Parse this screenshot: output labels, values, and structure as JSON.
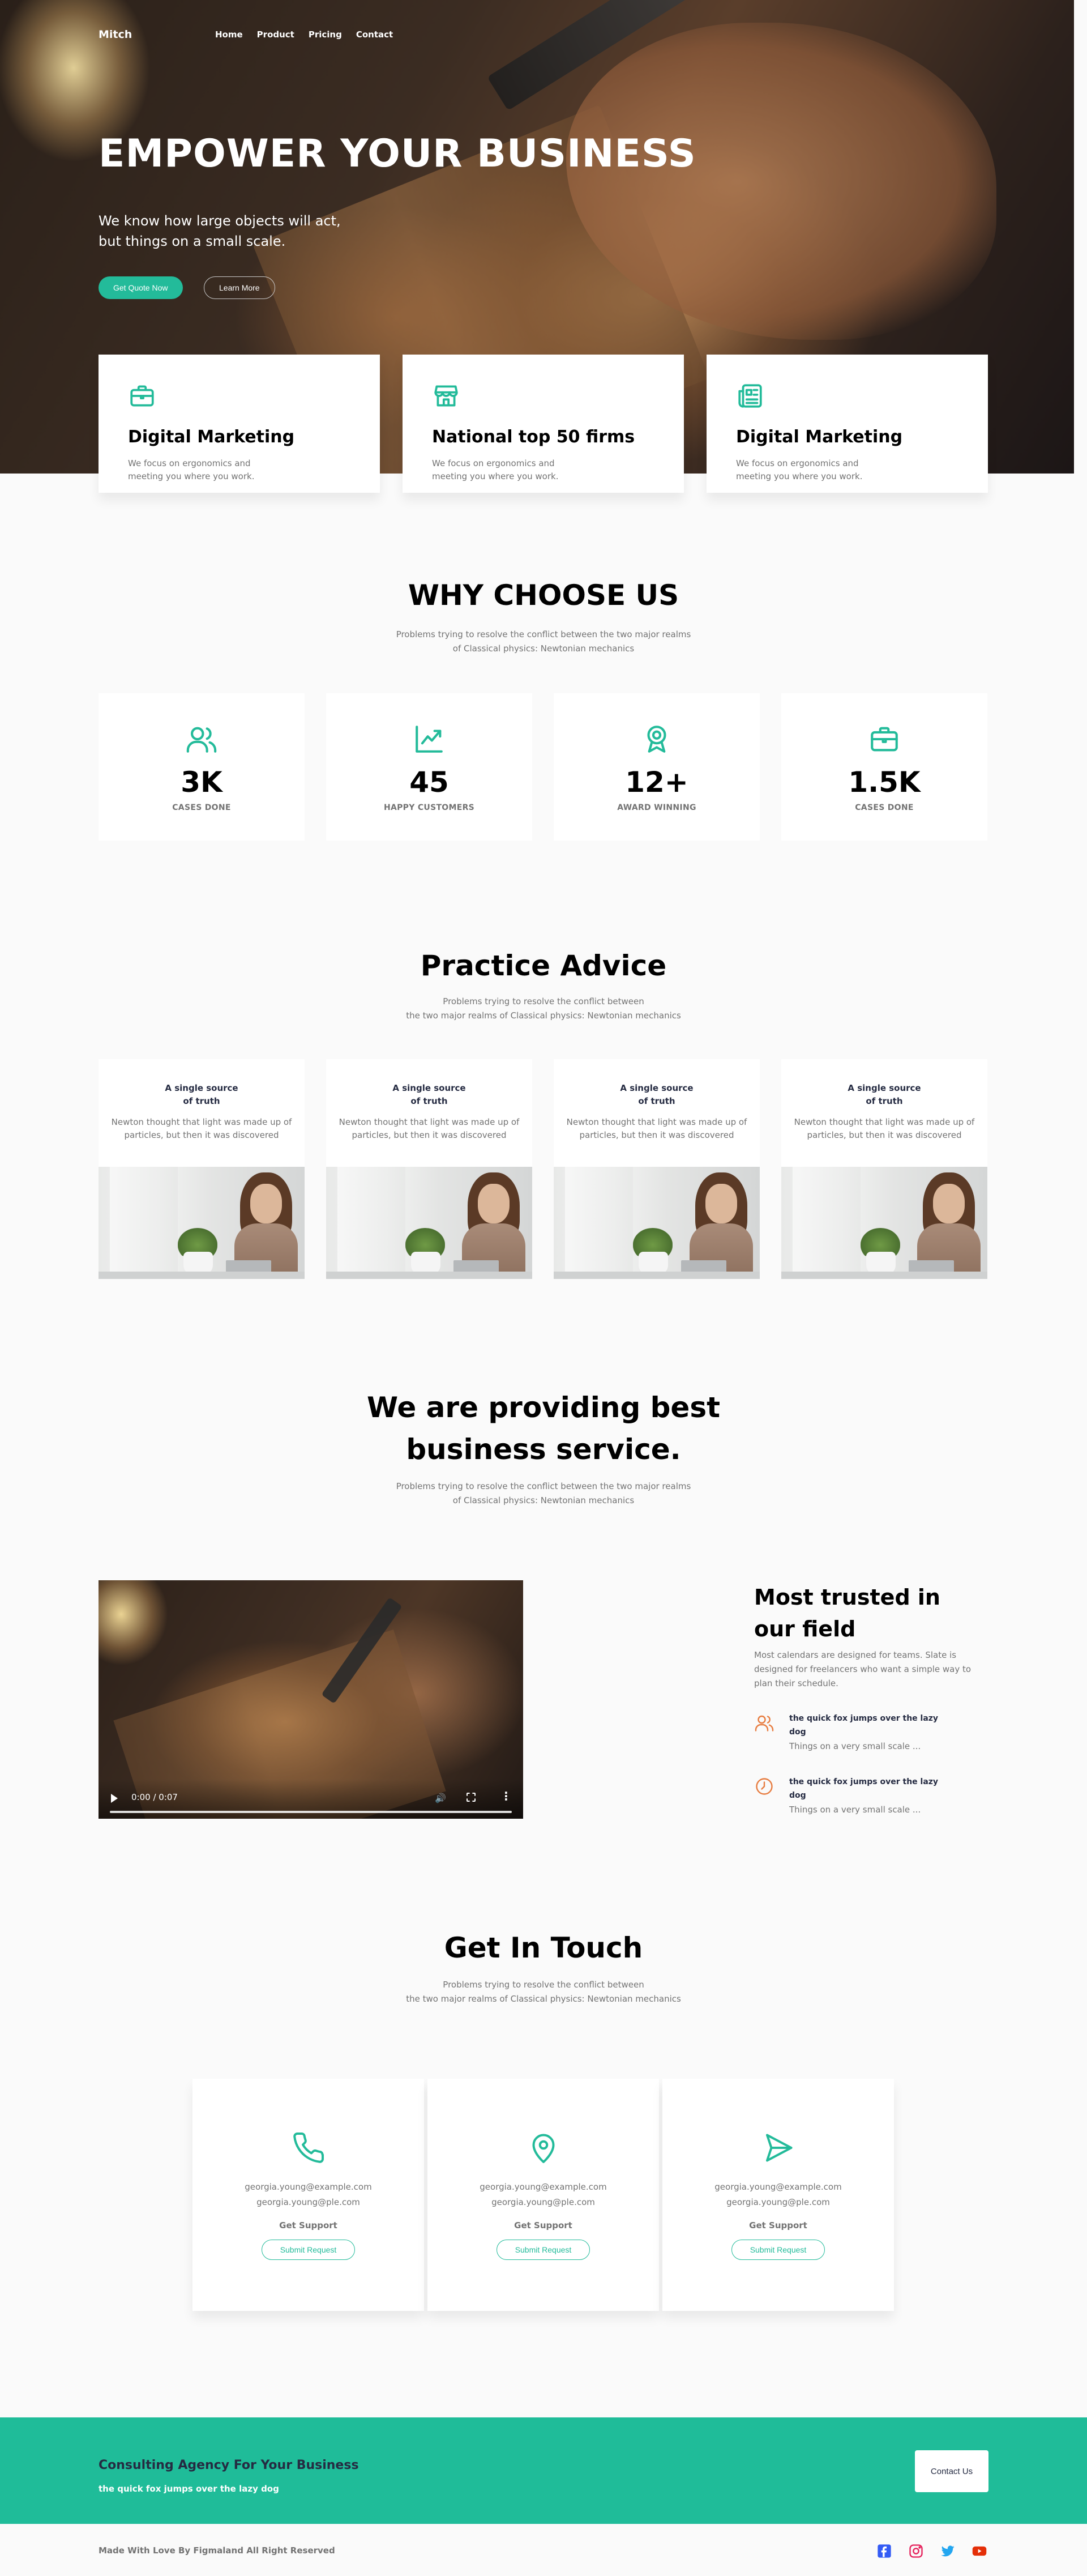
{
  "nav": {
    "logo": "Mitch",
    "links": [
      "Home",
      "Product",
      "Pricing",
      "Contact"
    ]
  },
  "hero": {
    "title": "EMPOWER YOUR BUSINESS",
    "subtitle": "We know how large objects will act, but things on a small scale.",
    "primary_button": "Get Quote Now",
    "secondary_button": "Learn More"
  },
  "feature_cards": [
    {
      "icon": "briefcase-icon",
      "title": "Digital Marketing",
      "text": "We focus on ergonomics and meeting you where you work."
    },
    {
      "icon": "store-icon",
      "title": "National top 50 firms",
      "text": "We focus on ergonomics and meeting you where you work."
    },
    {
      "icon": "newspaper-icon",
      "title": "Digital Marketing",
      "text": "We focus on ergonomics and meeting you where you work."
    }
  ],
  "why": {
    "title": "WHY CHOOSE US",
    "subtitle_line1": "Problems trying to resolve the conflict between the two major realms",
    "subtitle_line2": "of Classical physics: Newtonian mechanics"
  },
  "stats": [
    {
      "icon": "users-icon",
      "value": "3K",
      "label": "CASES DONE"
    },
    {
      "icon": "chart-line-icon",
      "value": "45",
      "label": "HAPPY CUSTOMERS"
    },
    {
      "icon": "award-icon",
      "value": "12+",
      "label": "AWARD WINNING"
    },
    {
      "icon": "briefcase-icon",
      "value": "1.5K",
      "label": "CASES DONE"
    }
  ],
  "practice": {
    "title": "Practice Advice",
    "subtitle_line1": "Problems trying to resolve the conflict between",
    "subtitle_line2": "the two major realms of Classical physics: Newtonian mechanics",
    "cards": [
      {
        "title_line1": "A single source",
        "title_line2": "of truth",
        "text_line1": "Newton thought that light was made up of",
        "text_line2": "particles, but then it was discovered"
      },
      {
        "title_line1": "A single source",
        "title_line2": "of truth",
        "text_line1": "Newton thought that light was made up of",
        "text_line2": "particles, but then it was discovered"
      },
      {
        "title_line1": "A single source",
        "title_line2": "of truth",
        "text_line1": "Newton thought that light was made up of",
        "text_line2": "particles, but then it was discovered"
      },
      {
        "title_line1": "A single source",
        "title_line2": "of truth",
        "text_line1": "Newton thought that light was made up of",
        "text_line2": "particles, but then it was discovered"
      }
    ]
  },
  "service": {
    "title_line1": "We are providing best",
    "title_line2": "business service.",
    "subtitle_line1": "Problems trying to resolve the conflict between the two major realms",
    "subtitle_line2": "of Classical physics: Newtonian mechanics",
    "video_time": "0:00 / 0:07"
  },
  "trusted": {
    "title_line1": "Most trusted in",
    "title_line2": "our field",
    "text": "Most calendars are designed for teams. Slate is designed for freelancers who want a simple way to plan their schedule.",
    "items": [
      {
        "icon": "users-icon",
        "heading_line1": "the quick fox jumps over the lazy",
        "heading_line2": "dog",
        "text": "Things on a very small scale ..."
      },
      {
        "icon": "clock-icon",
        "heading_line1": "the quick fox jumps over the lazy",
        "heading_line2": "dog",
        "text": "Things on a very small scale ..."
      }
    ]
  },
  "contact": {
    "title": "Get In Touch",
    "subtitle_line1": "Problems trying to resolve the conflict between",
    "subtitle_line2": "the two major realms of Classical physics: Newtonian mechanics",
    "cards": [
      {
        "icon": "phone-icon",
        "email1": "georgia.young@example.com",
        "email2": "georgia.young@ple.com",
        "support": "Get Support",
        "button": "Submit Request"
      },
      {
        "icon": "map-pin-icon",
        "email1": "georgia.young@example.com",
        "email2": "georgia.young@ple.com",
        "support": "Get Support",
        "button": "Submit Request"
      },
      {
        "icon": "send-icon",
        "email1": "georgia.young@example.com",
        "email2": "georgia.young@ple.com",
        "support": "Get Support",
        "button": "Submit Request"
      }
    ]
  },
  "footer": {
    "heading": "Consulting Agency For Your Business",
    "tagline": "the quick fox jumps over the lazy dog",
    "button": "Contact Us",
    "credit": "Made With Love By Figmaland All Right Reserved",
    "socials": [
      "facebook-icon",
      "instagram-icon",
      "twitter-icon",
      "youtube-icon"
    ]
  },
  "colors": {
    "primary": "#23BB9A",
    "dark_text": "#252B42",
    "second_text": "#737373",
    "footer_band": "#1FBC99",
    "background": "#FAFAFA",
    "orange_icon": "#E77C40",
    "facebook": "#335BF5",
    "instagram": "#E51F5A",
    "twitter": "#23A6F0",
    "youtube": "#E42F08"
  }
}
